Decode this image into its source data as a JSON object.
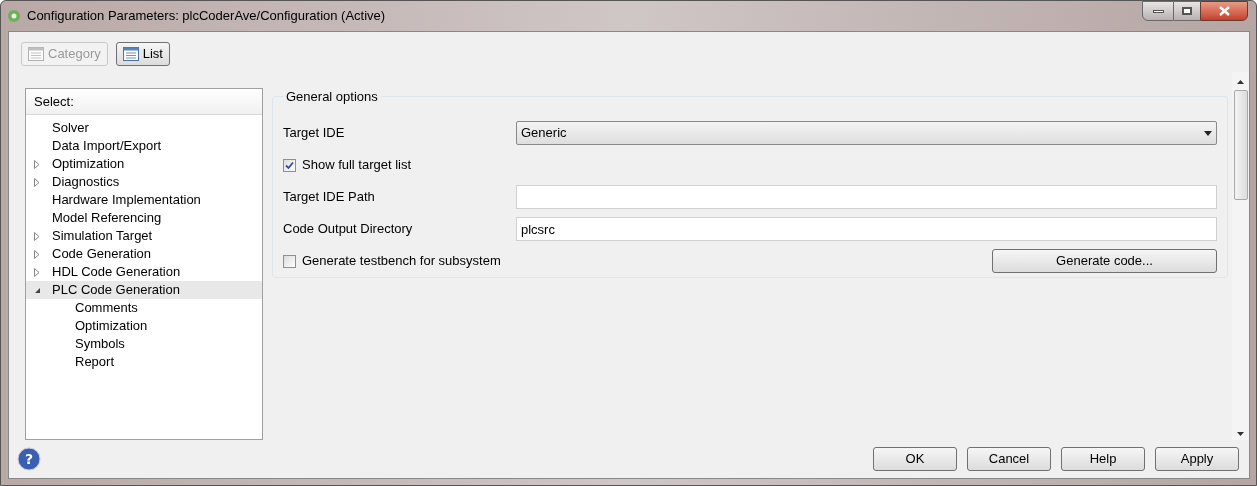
{
  "window": {
    "title": "Configuration Parameters: plcCoderAve/Configuration (Active)"
  },
  "toolbar": [
    {
      "label": "Category",
      "disabled": true
    },
    {
      "label": "List",
      "disabled": false
    }
  ],
  "tree": {
    "header": "Select:",
    "items": [
      {
        "label": "Solver",
        "expandable": false,
        "expanded": false,
        "selected": false
      },
      {
        "label": "Data Import/Export",
        "expandable": false,
        "expanded": false,
        "selected": false
      },
      {
        "label": "Optimization",
        "expandable": true,
        "expanded": false,
        "selected": false
      },
      {
        "label": "Diagnostics",
        "expandable": true,
        "expanded": false,
        "selected": false
      },
      {
        "label": "Hardware Implementation",
        "expandable": false,
        "expanded": false,
        "selected": false
      },
      {
        "label": "Model Referencing",
        "expandable": false,
        "expanded": false,
        "selected": false
      },
      {
        "label": "Simulation Target",
        "expandable": true,
        "expanded": false,
        "selected": false
      },
      {
        "label": "Code Generation",
        "expandable": true,
        "expanded": false,
        "selected": false
      },
      {
        "label": "HDL Code Generation",
        "expandable": true,
        "expanded": false,
        "selected": false
      },
      {
        "label": "PLC Code Generation",
        "expandable": true,
        "expanded": true,
        "selected": true,
        "children": [
          {
            "label": "Comments",
            "selected": false
          },
          {
            "label": "Optimization",
            "selected": false
          },
          {
            "label": "Symbols",
            "selected": false
          },
          {
            "label": "Report",
            "selected": false
          }
        ]
      }
    ]
  },
  "group": {
    "title": "General options",
    "rows": [
      {
        "kind": "dropdown",
        "label": "Target IDE",
        "value": "Generic"
      },
      {
        "kind": "checkbox",
        "label": "Show full target list",
        "checked": true
      },
      {
        "kind": "text",
        "label": "Target IDE Path"
      },
      {
        "kind": "text",
        "label": "Code Output Directory",
        "value": "plcsrc"
      },
      {
        "kind": "checkbox",
        "label": "Generate testbench for subsystem",
        "checked": false,
        "button": "Generate code..."
      }
    ]
  },
  "help": "?",
  "buttons": [
    "OK",
    "Cancel",
    "Help",
    "Apply"
  ]
}
